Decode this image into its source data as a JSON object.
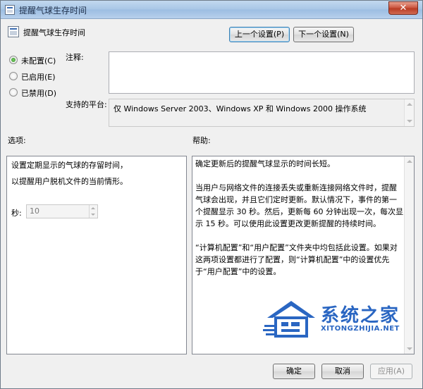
{
  "window": {
    "title": "提醒气球生存时间",
    "close_glyph": "✕"
  },
  "header": {
    "policy_title": "提醒气球生存时间",
    "prev_button": "上一个设置(P)",
    "next_button": "下一个设置(N)"
  },
  "state": {
    "options": [
      {
        "label": "未配置(C)",
        "selected": true
      },
      {
        "label": "已启用(E)",
        "selected": false
      },
      {
        "label": "已禁用(D)",
        "selected": false
      }
    ]
  },
  "comment": {
    "label": "注释:",
    "value": ""
  },
  "supported": {
    "label": "支持的平台:",
    "value": "仅 Windows Server 2003、Windows XP 和 Windows 2000 操作系统"
  },
  "options_panel": {
    "heading": "选项:",
    "line1": "设置定期显示的气球的存留时间，",
    "line2": "以提醒用户脱机文件的当前情形。",
    "seconds_label": "秒:",
    "seconds_value": "10"
  },
  "help_panel": {
    "heading": "帮助:",
    "paragraphs": [
      "确定更新后的提醒气球显示的时间长短。",
      "当用户与网络文件的连接丢失或重新连接网络文件时，提醒气球会出现，并且它们定时更新。默认情况下，事件的第一个提醒显示 30 秒。然后，更新每 60 分钟出现一次，每次显示 15 秒。可以使用此设置更改更新提醒的持续时间。",
      "“计算机配置”和“用户配置”文件夹中均包括此设置。如果对这两项设置都进行了配置，则“计算机配置”中的设置优先于“用户配置”中的设置。"
    ]
  },
  "footer": {
    "ok": "确定",
    "cancel": "取消",
    "apply": "应用(A)"
  },
  "watermark": {
    "brand": "系统之家",
    "url": "XITONGZHIJIA.NET"
  },
  "colors": {
    "watermark_blue": "#2a66c2",
    "radio_selected": "#2f8f22",
    "close_red": "#c9513a"
  }
}
